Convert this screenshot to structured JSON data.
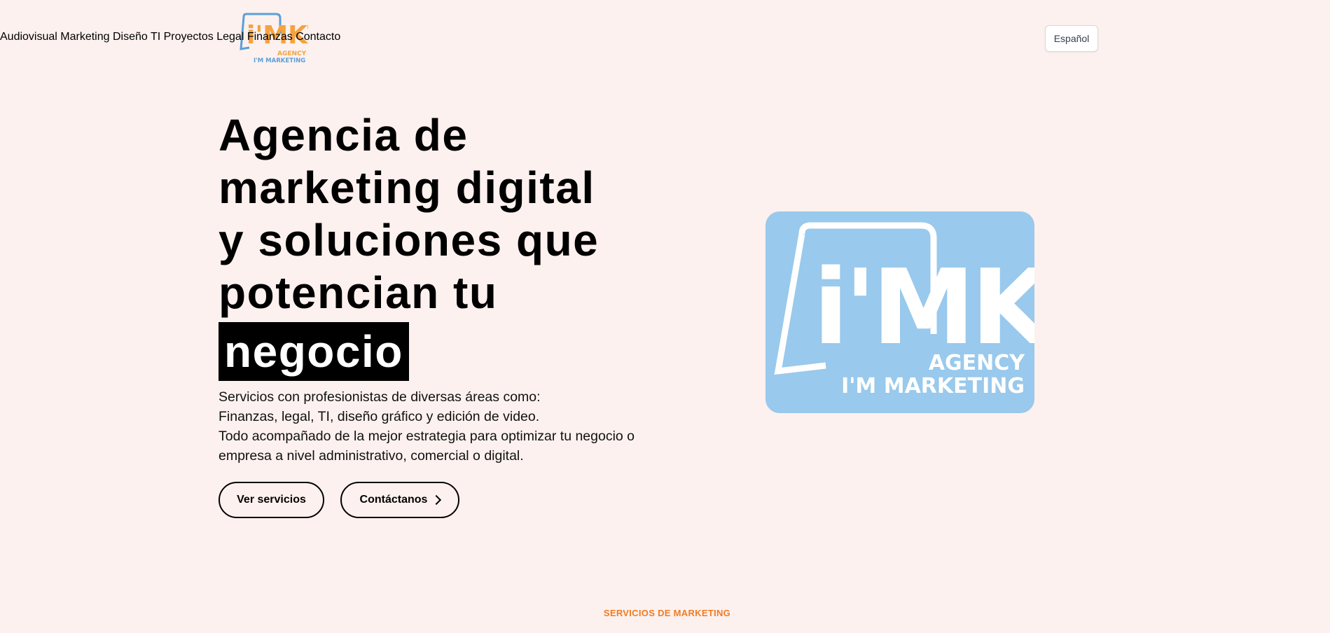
{
  "brand": {
    "logo_mark": "i'MKT",
    "logo_sub1": "AGENCY",
    "logo_sub2": "I'M MARKETING",
    "colors": {
      "orange": "#f4a340",
      "blue": "#5b9fd8",
      "light_blue": "#99c9ec",
      "accent": "#f07c23",
      "background": "#fcf1ee"
    }
  },
  "nav": {
    "items": [
      {
        "label": "Audiovisual"
      },
      {
        "label": "Marketing"
      },
      {
        "label": "Diseño"
      },
      {
        "label": "TI"
      },
      {
        "label": "Proyectos"
      },
      {
        "label": "Legal"
      },
      {
        "label": "Finanzas"
      },
      {
        "label": "Contacto"
      }
    ],
    "language": "Español"
  },
  "hero": {
    "title_lines": [
      "Agencia de",
      "marketing digital",
      "y soluciones que",
      "potencian tu"
    ],
    "title_highlight": "negocio",
    "description_lines": [
      "Servicios con profesionistas de diversas áreas como:",
      "Finanzas, legal, TI, diseño gráfico y edición de video.",
      "Todo acompañado de la mejor estrategia para optimizar tu negocio o",
      "empresa a nivel administrativo, comercial o digital."
    ],
    "buttons": {
      "services": "Ver servicios",
      "contact": "Contáctanos"
    }
  },
  "section": {
    "label": "SERVICIOS DE MARKETING"
  }
}
